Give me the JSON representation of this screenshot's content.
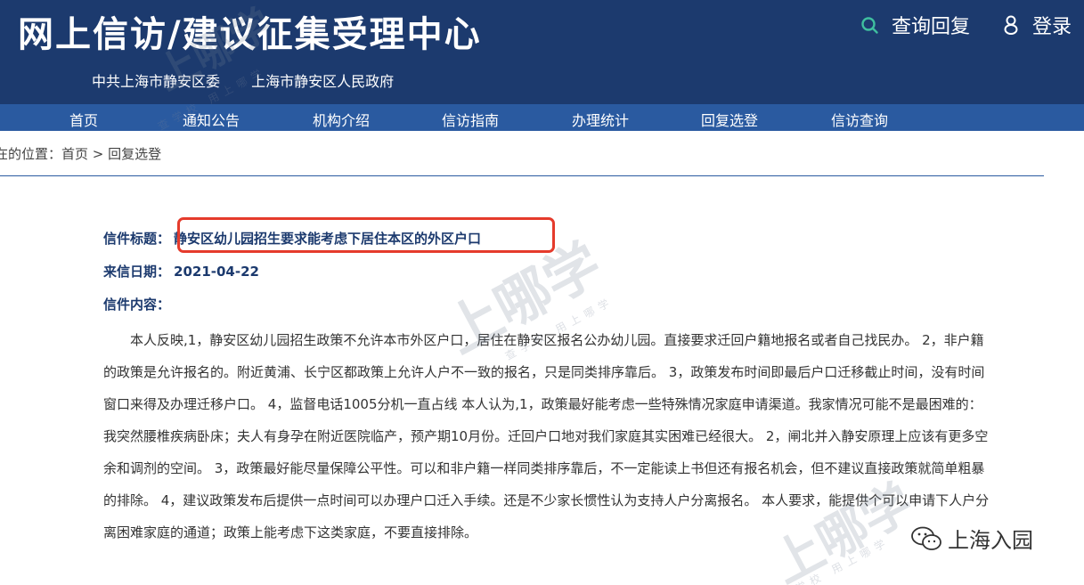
{
  "header": {
    "title": "网上信访/建议征集受理中心",
    "orgs": [
      "中共上海市静安区委",
      "上海市静安区人民政府"
    ],
    "search_label": "查询回复",
    "login_label": "登录",
    "bg_color": "#1c3a6e"
  },
  "nav": {
    "items": [
      "首页",
      "通知公告",
      "机构介绍",
      "信访指南",
      "办理统计",
      "回复选登",
      "信访查询"
    ],
    "bg_color": "#2a5aa0"
  },
  "breadcrumb": "在的位置：首页 > 回复选登",
  "letter": {
    "title_label": "信件标题：",
    "title": "静安区幼儿园招生要求能考虑下居住本区的外区户口",
    "date_label": "来信日期：",
    "date": "2021-04-22",
    "content_label": "信件内容：",
    "content": "本人反映,1，静安区幼儿园招生政策不允许本市外区户口，居住在静安区报名公办幼儿园。直接要求迁回户籍地报名或者自己找民办。 2，非户籍的政策是允许报名的。附近黄浦、长宁区都政策上允许人户不一致的报名，只是同类排序靠后。 3，政策发布时间即最后户口迁移截止时间，没有时间窗口来得及办理迁移户口。 4，监督电话1005分机一直占线 本人认为,1，政策最好能考虑一些特殊情况家庭申请渠道。我家情况可能不是最困难的：我突然腰椎疾病卧床；夫人有身孕在附近医院临产，预产期10月份。迁回户口地对我们家庭其实困难已经很大。 2，闸北并入静安原理上应该有更多空余和调剂的空间。 3，政策最好能尽量保障公平性。可以和非户籍一样同类排序靠后，不一定能读上书但还有报名机会，但不建议直接政策就简单粗暴的排除。 4，建议政策发布后提供一点时间可以办理户口迁入手续。还是不少家长惯性认为支持人户分离报名。 本人要求，能提供个可以申请下人户分离困难家庭的通道；政策上能考虑下这类家庭，不要直接排除。",
    "highlight_color": "#e53b2c"
  },
  "watermark": {
    "big": "上哪学",
    "small": "查学校 用上哪学",
    "wechat_name": "上海入园"
  }
}
